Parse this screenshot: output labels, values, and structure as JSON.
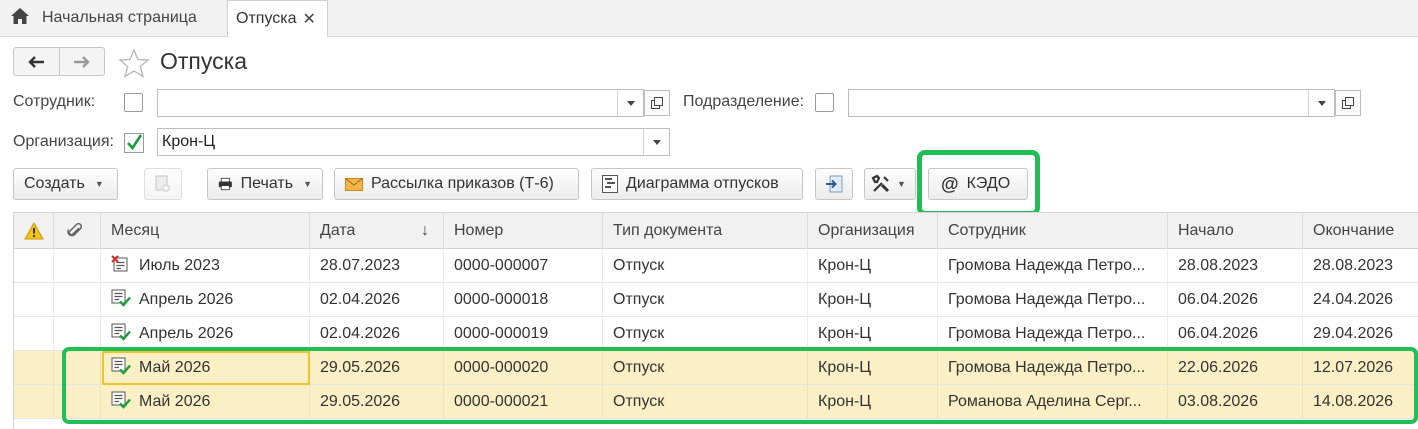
{
  "tabs": {
    "home_label": "Начальная страница",
    "active_label": "Отпуска",
    "close_glyph": "✕"
  },
  "page": {
    "title": "Отпуска"
  },
  "filters": {
    "employee_label": "Сотрудник:",
    "employee_value": "",
    "employee_checked": false,
    "department_label": "Подразделение:",
    "department_value": "",
    "department_checked": false,
    "organization_label": "Организация:",
    "organization_value": "Крон-Ц",
    "organization_checked": true
  },
  "toolbar": {
    "create": "Создать",
    "print": "Печать",
    "mailing": "Рассылка приказов (Т-6)",
    "diagram": "Диаграмма отпусков",
    "kedo": "КЭДО"
  },
  "table": {
    "columns": [
      "Месяц",
      "Дата",
      "Номер",
      "Тип документа",
      "Организация",
      "Сотрудник",
      "Начало",
      "Окончание"
    ],
    "sort_indicator": "↓",
    "rows": [
      {
        "icon": "document-deleted-icon",
        "month": "Июль 2023",
        "date": "28.07.2023",
        "number": "0000-000007",
        "type": "Отпуск",
        "org": "Крон-Ц",
        "employee": "Громова Надежда Петро...",
        "start": "28.08.2023",
        "end": "28.08.2023",
        "selected": false
      },
      {
        "icon": "document-posted-icon",
        "month": "Апрель 2026",
        "date": "02.04.2026",
        "number": "0000-000018",
        "type": "Отпуск",
        "org": "Крон-Ц",
        "employee": "Громова Надежда Петро...",
        "start": "06.04.2026",
        "end": "24.04.2026",
        "selected": false
      },
      {
        "icon": "document-posted-icon",
        "month": "Апрель 2026",
        "date": "02.04.2026",
        "number": "0000-000019",
        "type": "Отпуск",
        "org": "Крон-Ц",
        "employee": "Громова Надежда Петро...",
        "start": "06.04.2026",
        "end": "29.04.2026",
        "selected": false
      },
      {
        "icon": "document-posted-icon",
        "month": "Май 2026",
        "date": "29.05.2026",
        "number": "0000-000020",
        "type": "Отпуск",
        "org": "Крон-Ц",
        "employee": "Громова Надежда Петро...",
        "start": "22.06.2026",
        "end": "12.07.2026",
        "selected": true
      },
      {
        "icon": "document-posted-icon",
        "month": "Май 2026",
        "date": "29.05.2026",
        "number": "0000-000021",
        "type": "Отпуск",
        "org": "Крон-Ц",
        "employee": "Романова Аделина Серг...",
        "start": "03.08.2026",
        "end": "14.08.2026",
        "selected": true
      }
    ]
  },
  "colors": {
    "highlight_green": "#1fbf55",
    "selected_row": "#fbefc6",
    "focus_cell": "#f0c232"
  }
}
